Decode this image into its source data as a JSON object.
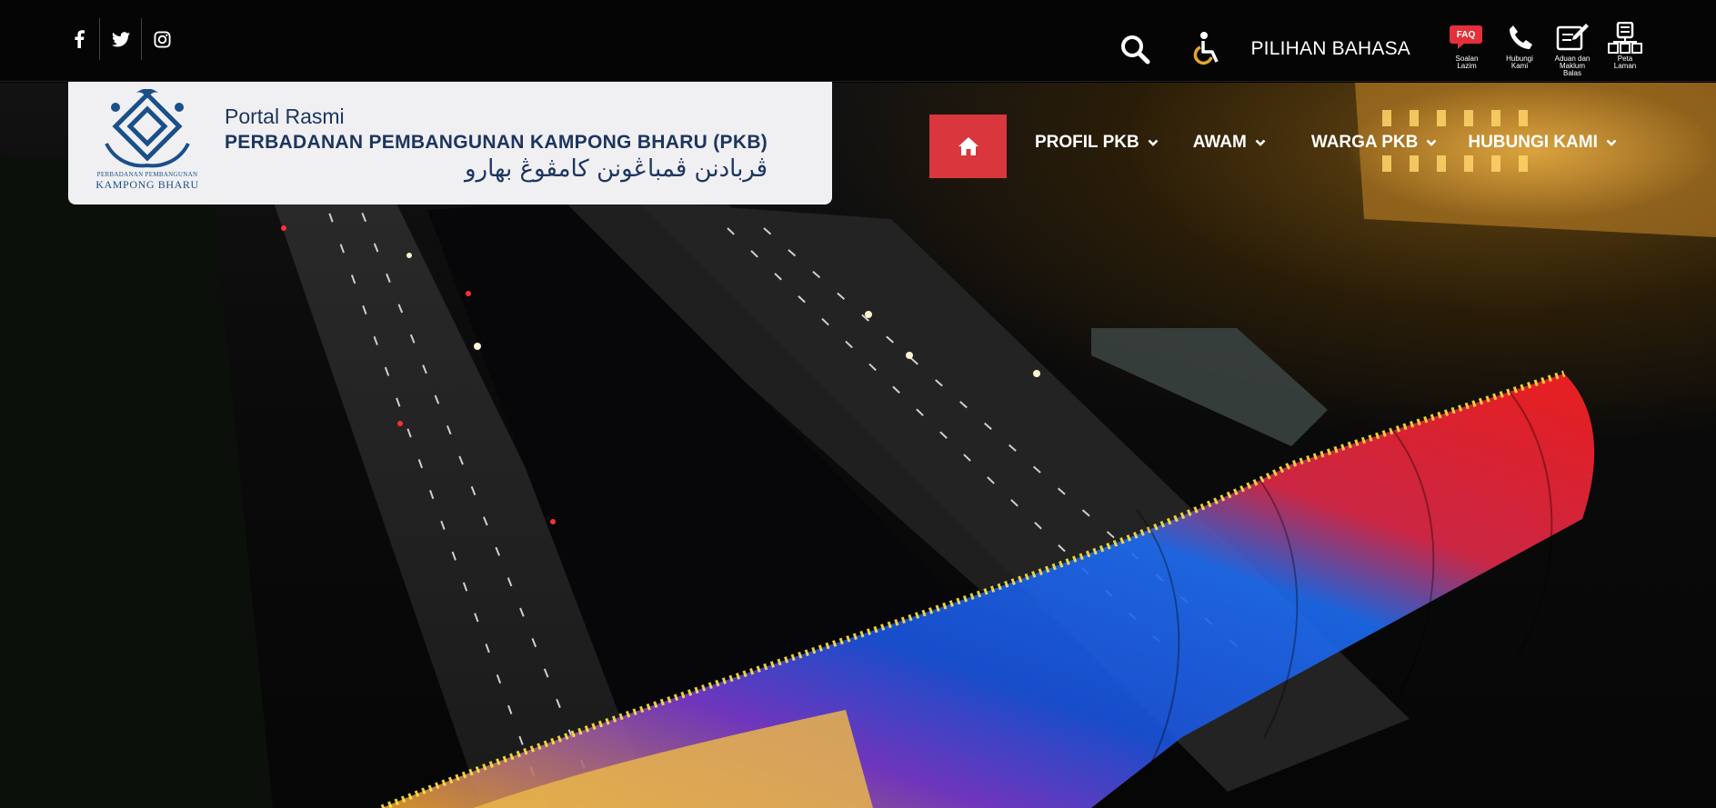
{
  "header": {
    "social": [
      "facebook-icon",
      "twitter-icon",
      "instagram-icon"
    ],
    "language_label": "PILIHAN BAHASA",
    "quick_links": [
      {
        "icon": "faq-icon",
        "badge": "FAQ",
        "line1": "Soalan",
        "line2": "Lazim"
      },
      {
        "icon": "phone-icon",
        "line1": "Hubungi",
        "line2": "Kami"
      },
      {
        "icon": "feedback-icon",
        "line1": "Aduan dan",
        "line2": "Maklum Balas"
      },
      {
        "icon": "sitemap-icon",
        "line1": "Peta",
        "line2": "Laman"
      }
    ]
  },
  "logo": {
    "line1": "Portal Rasmi",
    "line2": "PERBADANAN PEMBANGUNAN KAMPONG BHARU (PKB)",
    "line3": "ڤربادنن ڤمباڠونن كامڤوڠ بهارو",
    "emblem_caption_small": "PERBADANAN PEMBANGUNAN",
    "emblem_caption": "KAMPONG BHARU"
  },
  "nav": {
    "home_icon": "home-icon",
    "items": [
      {
        "label": "PROFIL PKB"
      },
      {
        "label": "AWAM"
      },
      {
        "label": "WARGA PKB"
      },
      {
        "label": "HUBUNGI KAMI"
      }
    ]
  },
  "colors": {
    "topbar": "#050505",
    "accent_red": "#d9363e",
    "brand_blue": "#1e3560",
    "logo_bg": "#f0f0f2"
  }
}
